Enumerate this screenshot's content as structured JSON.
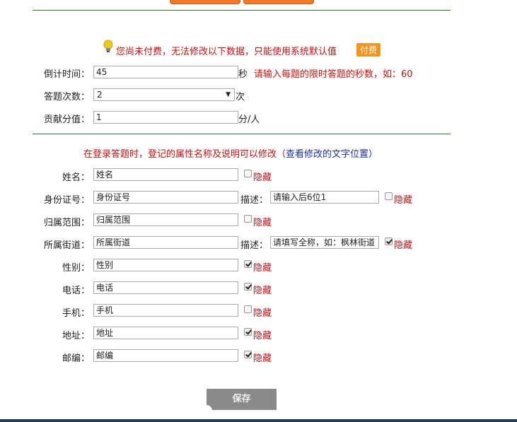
{
  "notice": {
    "icon": "lightbulb-icon",
    "text": "您尚未付费，无法修改以下数据，只能使用系统默认值",
    "pay_label": "付费"
  },
  "settings": {
    "countdown": {
      "label": "倒计时间：",
      "value": "45",
      "unit": "秒",
      "hint": "请输入每题的限时答题的秒数，如：60"
    },
    "attempts": {
      "label": "答题次数：",
      "value": "2",
      "unit": "次"
    },
    "contribution": {
      "label": "贡献分值：",
      "value": "1",
      "unit": "分/人"
    }
  },
  "attr_notice": {
    "text": "在登录答题时，登记的属性名称及说明可以修改（",
    "link": "查看修改的文字位置",
    "close": "）"
  },
  "fields": [
    {
      "label": "姓名：",
      "value": "姓名",
      "hidden": false,
      "hide_label": "隐藏"
    },
    {
      "label": "身份证号：",
      "value": "身份证号",
      "desc_label": "描述：",
      "desc_value": "请输入后6位1",
      "hidden": false,
      "hide_label": "隐藏"
    },
    {
      "label": "归属范围：",
      "value": "归属范围",
      "hidden": false,
      "hide_label": "隐藏"
    },
    {
      "label": "所属街道：",
      "value": "所属街道",
      "desc_label": "描述：",
      "desc_value": "请填写全称，如：枫林街道",
      "hidden": true,
      "hide_label": "隐藏"
    },
    {
      "label": "性别：",
      "value": "性别",
      "hidden": true,
      "hide_label": "隐藏"
    },
    {
      "label": "电话：",
      "value": "电话",
      "hidden": true,
      "hide_label": "隐藏"
    },
    {
      "label": "手机：",
      "value": "手机",
      "hidden": false,
      "hide_label": "隐藏"
    },
    {
      "label": "地址：",
      "value": "地址",
      "hidden": true,
      "hide_label": "隐藏"
    },
    {
      "label": "邮编：",
      "value": "邮编",
      "hidden": true,
      "hide_label": "隐藏"
    }
  ],
  "save_label": "保存",
  "colors": {
    "accent": "#f07a28",
    "warning": "#cc1111",
    "link": "#1a2fa8",
    "divider": "#2a7a2a",
    "button": "#8a8a8a"
  }
}
